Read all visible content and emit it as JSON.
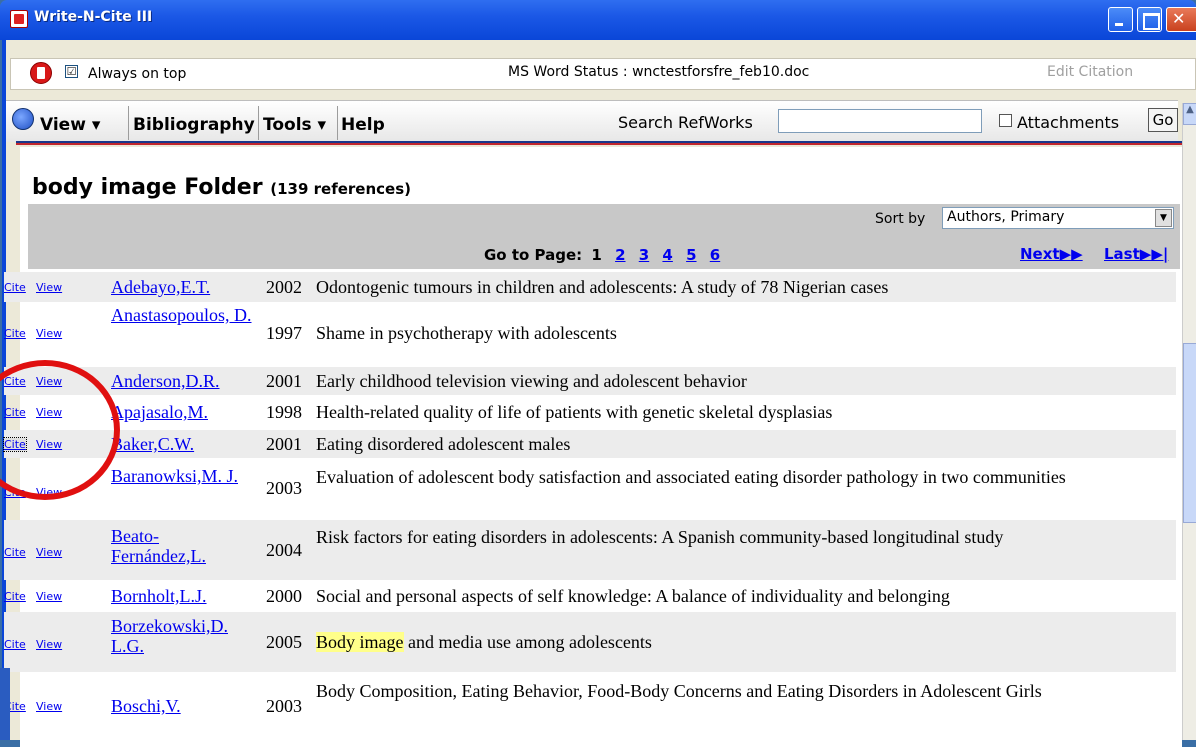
{
  "window": {
    "title": "Write-N-Cite III"
  },
  "statusbar": {
    "always_on_top_label": "Always on top",
    "always_on_top_checked": "☑",
    "word_status": "MS Word Status : wnctestforsfre_feb10.doc",
    "edit_citation": "Edit Citation"
  },
  "menu": {
    "view": "View ▾",
    "bibliography": "Bibliography",
    "tools": "Tools ▾",
    "help": "Help",
    "search_label": "Search RefWorks",
    "search_value": "",
    "attachments_label": "Attachments",
    "go": "Go"
  },
  "folder": {
    "title": "body image Folder",
    "count": "(139 references)",
    "sort_label": "Sort by",
    "sort_value": "Authors, Primary",
    "goto_label": "Go to Page:",
    "current_page": "1",
    "pages": [
      "2",
      "3",
      "4",
      "5",
      "6"
    ],
    "next": "Next▶▶",
    "last": "Last▶▶|"
  },
  "refs": [
    {
      "author": "Adebayo,E.T.",
      "year": "2002",
      "title": "Odontogenic tumours in children and adolescents: A study of 78 Nigerian cases"
    },
    {
      "author": "Anastasopoulos, D.",
      "year": "1997",
      "title": "Shame in psychotherapy with adolescents"
    },
    {
      "author": "Anderson,D.R.",
      "year": "2001",
      "title": "Early childhood television viewing and adolescent behavior"
    },
    {
      "author": "Apajasalo,M.",
      "year": "1998",
      "title": "Health-related quality of life of patients with genetic skeletal dysplasias"
    },
    {
      "author": "Baker,C.W.",
      "year": "2001",
      "title": "Eating disordered adolescent males"
    },
    {
      "author": "Baranowksi,M. J.",
      "year": "2003",
      "title": "Evaluation of adolescent body satisfaction and associated eating disorder pathology in two communities"
    },
    {
      "author": "Beato-Fernández,L.",
      "year": "2004",
      "title": "Risk factors for eating disorders in adolescents: A Spanish community-based longitudinal study"
    },
    {
      "author": "Bornholt,L.J.",
      "year": "2000",
      "title": "Social and personal aspects of self knowledge: A balance of individuality and belonging"
    },
    {
      "author": "Borzekowski,D. L.G.",
      "year": "2005",
      "title_hl": "Body image",
      "title_rest": " and media use among adolescents"
    },
    {
      "author": "Boschi,V.",
      "year": "2003",
      "title": "Body Composition, Eating Behavior, Food-Body Concerns and Eating Disorders in Adolescent Girls"
    }
  ],
  "row_action": {
    "cite": "Cite",
    "view": "View"
  }
}
